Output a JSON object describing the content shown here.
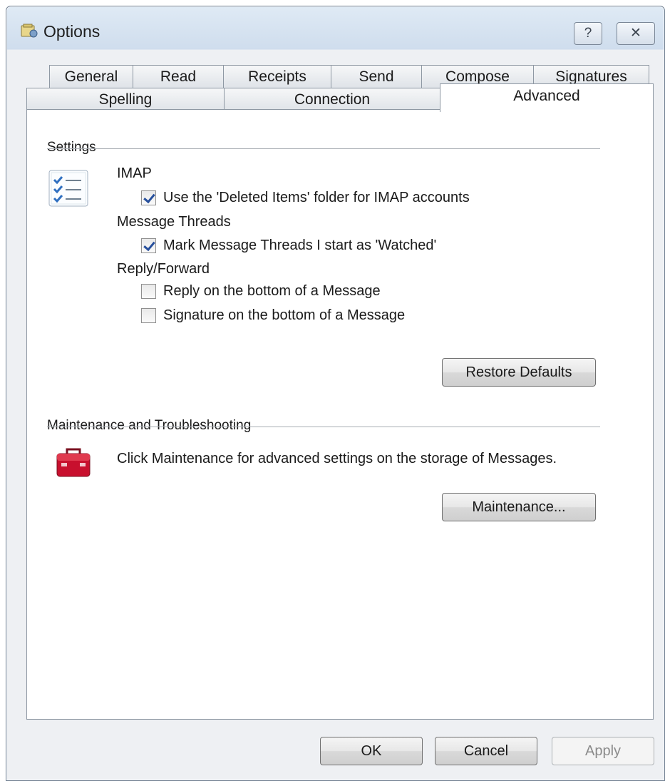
{
  "window": {
    "title": "Options"
  },
  "caption": {
    "help": "?",
    "close": "✕"
  },
  "tabs": {
    "row1": [
      "General",
      "Read",
      "Receipts",
      "Send",
      "Compose",
      "Signatures"
    ],
    "row2": [
      "Spelling",
      "Connection",
      "Advanced"
    ],
    "active": "Advanced"
  },
  "settings": {
    "section_label": "Settings",
    "imap": {
      "label": "IMAP",
      "deleted_items": {
        "label": "Use the 'Deleted Items' folder for IMAP accounts",
        "checked": true
      }
    },
    "threads": {
      "label": "Message Threads",
      "watched": {
        "label": "Mark Message Threads I start as 'Watched'",
        "checked": true
      }
    },
    "reply": {
      "label": "Reply/Forward",
      "reply_bottom": {
        "label": "Reply on the bottom of a Message",
        "checked": false
      },
      "signature_bottom": {
        "label": "Signature on the bottom of a Message",
        "checked": false
      }
    },
    "restore_button": "Restore Defaults"
  },
  "maintenance": {
    "section_label": "Maintenance and Troubleshooting",
    "description": "Click Maintenance for advanced settings on the storage of Messages.",
    "button": "Maintenance..."
  },
  "footer": {
    "ok": "OK",
    "cancel": "Cancel",
    "apply": "Apply"
  },
  "icons": {
    "app": "options-app-icon",
    "settings": "checklist-icon",
    "maintenance": "toolbox-icon"
  },
  "colors": {
    "check_accent": "#264f9c",
    "toolbox": "#c8102e"
  }
}
